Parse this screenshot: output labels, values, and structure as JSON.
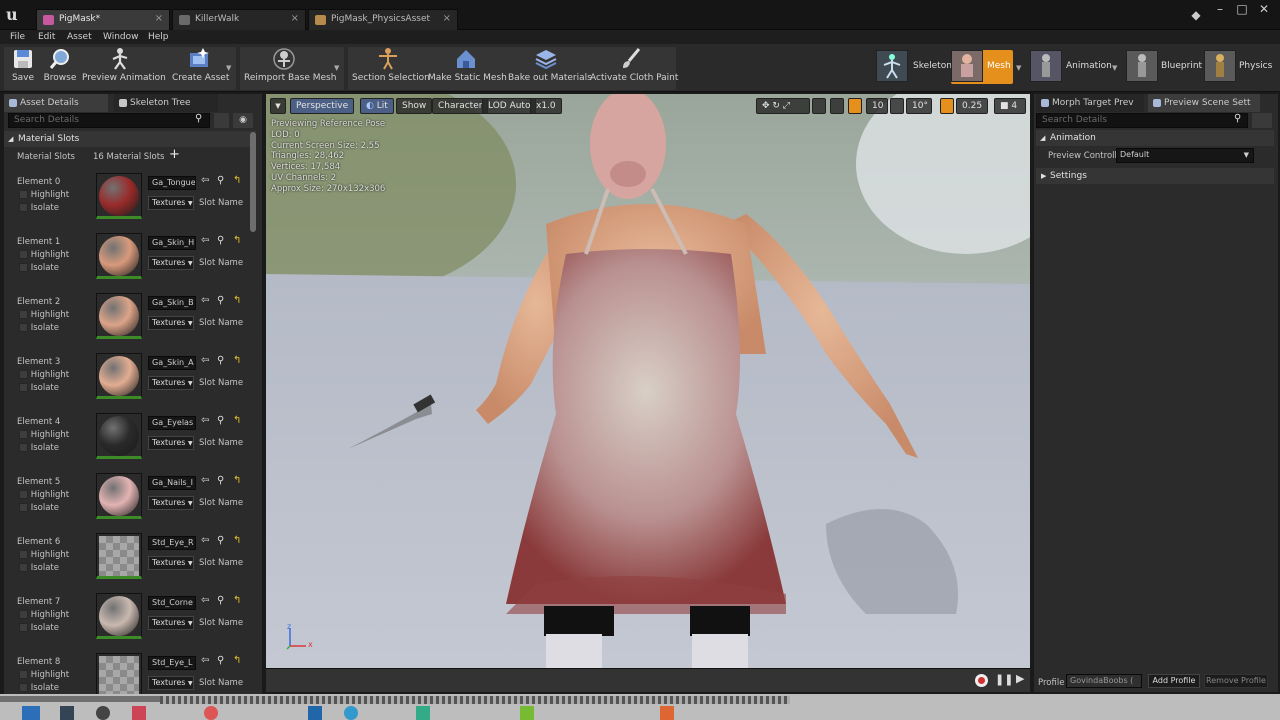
{
  "window": {
    "tabs": [
      {
        "label": "PigMask*",
        "active": true
      },
      {
        "label": "KillerWalk",
        "active": false
      },
      {
        "label": "PigMask_PhysicsAsset",
        "active": false
      }
    ]
  },
  "menu": {
    "items": [
      "File",
      "Edit",
      "Asset",
      "Window",
      "Help"
    ]
  },
  "toolbar": {
    "buttons": [
      {
        "label": "Save",
        "icon": "save-icon"
      },
      {
        "label": "Browse",
        "icon": "magnifier-icon"
      },
      {
        "label": "Preview Animation",
        "icon": "running-figure-icon"
      },
      {
        "label": "Create Asset",
        "icon": "create-asset-icon"
      },
      {
        "label": "Reimport Base Mesh",
        "icon": "reimport-icon"
      },
      {
        "label": "Section Selection",
        "icon": "section-selection-icon"
      },
      {
        "label": "Make Static Mesh",
        "icon": "house-icon"
      },
      {
        "label": "Bake out Materials",
        "icon": "layers-icon"
      },
      {
        "label": "Activate Cloth Paint",
        "icon": "paint-brush-icon"
      }
    ],
    "modes": [
      {
        "label": "Skeleton"
      },
      {
        "label": "Mesh",
        "active": true
      },
      {
        "label": "Animation"
      },
      {
        "label": "Blueprint"
      },
      {
        "label": "Physics"
      }
    ]
  },
  "left_panel": {
    "tabs": [
      "Asset Details",
      "Skeleton Tree"
    ],
    "search_placeholder": "Search Details",
    "section_title": "Material Slots",
    "slots_label": "Material Slots",
    "slots_count": "16 Material Slots",
    "highlight_label": "Highlight",
    "isolate_label": "Isolate",
    "textures_label": "Textures",
    "slot_name_label": "Slot Name",
    "elements": [
      {
        "label": "Element 0",
        "material": "Ga_Tongue",
        "thumb_color": "#9a2b2b"
      },
      {
        "label": "Element 1",
        "material": "Ga_Skin_H",
        "thumb_color": "#d89a7c"
      },
      {
        "label": "Element 2",
        "material": "Ga_Skin_B",
        "thumb_color": "#dca489"
      },
      {
        "label": "Element 3",
        "material": "Ga_Skin_A",
        "thumb_color": "#e2ad92"
      },
      {
        "label": "Element 4",
        "material": "Ga_Eyelas",
        "thumb_color": "#2a2a2a"
      },
      {
        "label": "Element 5",
        "material": "Ga_Nails_I",
        "thumb_color": "#e3b3b3"
      },
      {
        "label": "Element 6",
        "material": "Std_Eye_R",
        "thumb_color": "#9a9a9a"
      },
      {
        "label": "Element 7",
        "material": "Std_Corne",
        "thumb_color": "#c9b9b0"
      },
      {
        "label": "Element 8",
        "material": "Std_Eye_L",
        "thumb_color": "#9a9a9a"
      }
    ]
  },
  "viewport": {
    "buttons": {
      "perspective": "Perspective",
      "lit": "Lit",
      "show": "Show",
      "character": "Character",
      "lod": "LOD Auto",
      "speed": "x1.0"
    },
    "right_controls": {
      "grid": "10",
      "angle": "10°",
      "scale": "0.25",
      "cam_speed": "4"
    },
    "info": [
      "Previewing Reference Pose",
      "LOD: 0",
      "Current Screen Size: 2.55",
      "Triangles: 28,462",
      "Vertices: 17,584",
      "UV Channels: 2",
      "Approx Size: 270x132x306"
    ],
    "axes": {
      "z": "z",
      "x": "x"
    }
  },
  "right_panel": {
    "tabs": [
      "Morph Target Prev",
      "Preview Scene Sett"
    ],
    "search_placeholder": "Search Details",
    "animation_header": "Animation",
    "preview_controller_label": "Preview Controller",
    "preview_controller_value": "Default",
    "settings_header": "Settings",
    "profile_label": "Profile",
    "profile_value": "GovindaBoobs (",
    "add_profile": "Add Profile",
    "remove_profile": "Remove Profile"
  },
  "colors": {
    "accent_orange": "#e5901c",
    "active_tab_blue": "#4d6a9e",
    "thumb_green": "#3d8b26"
  }
}
